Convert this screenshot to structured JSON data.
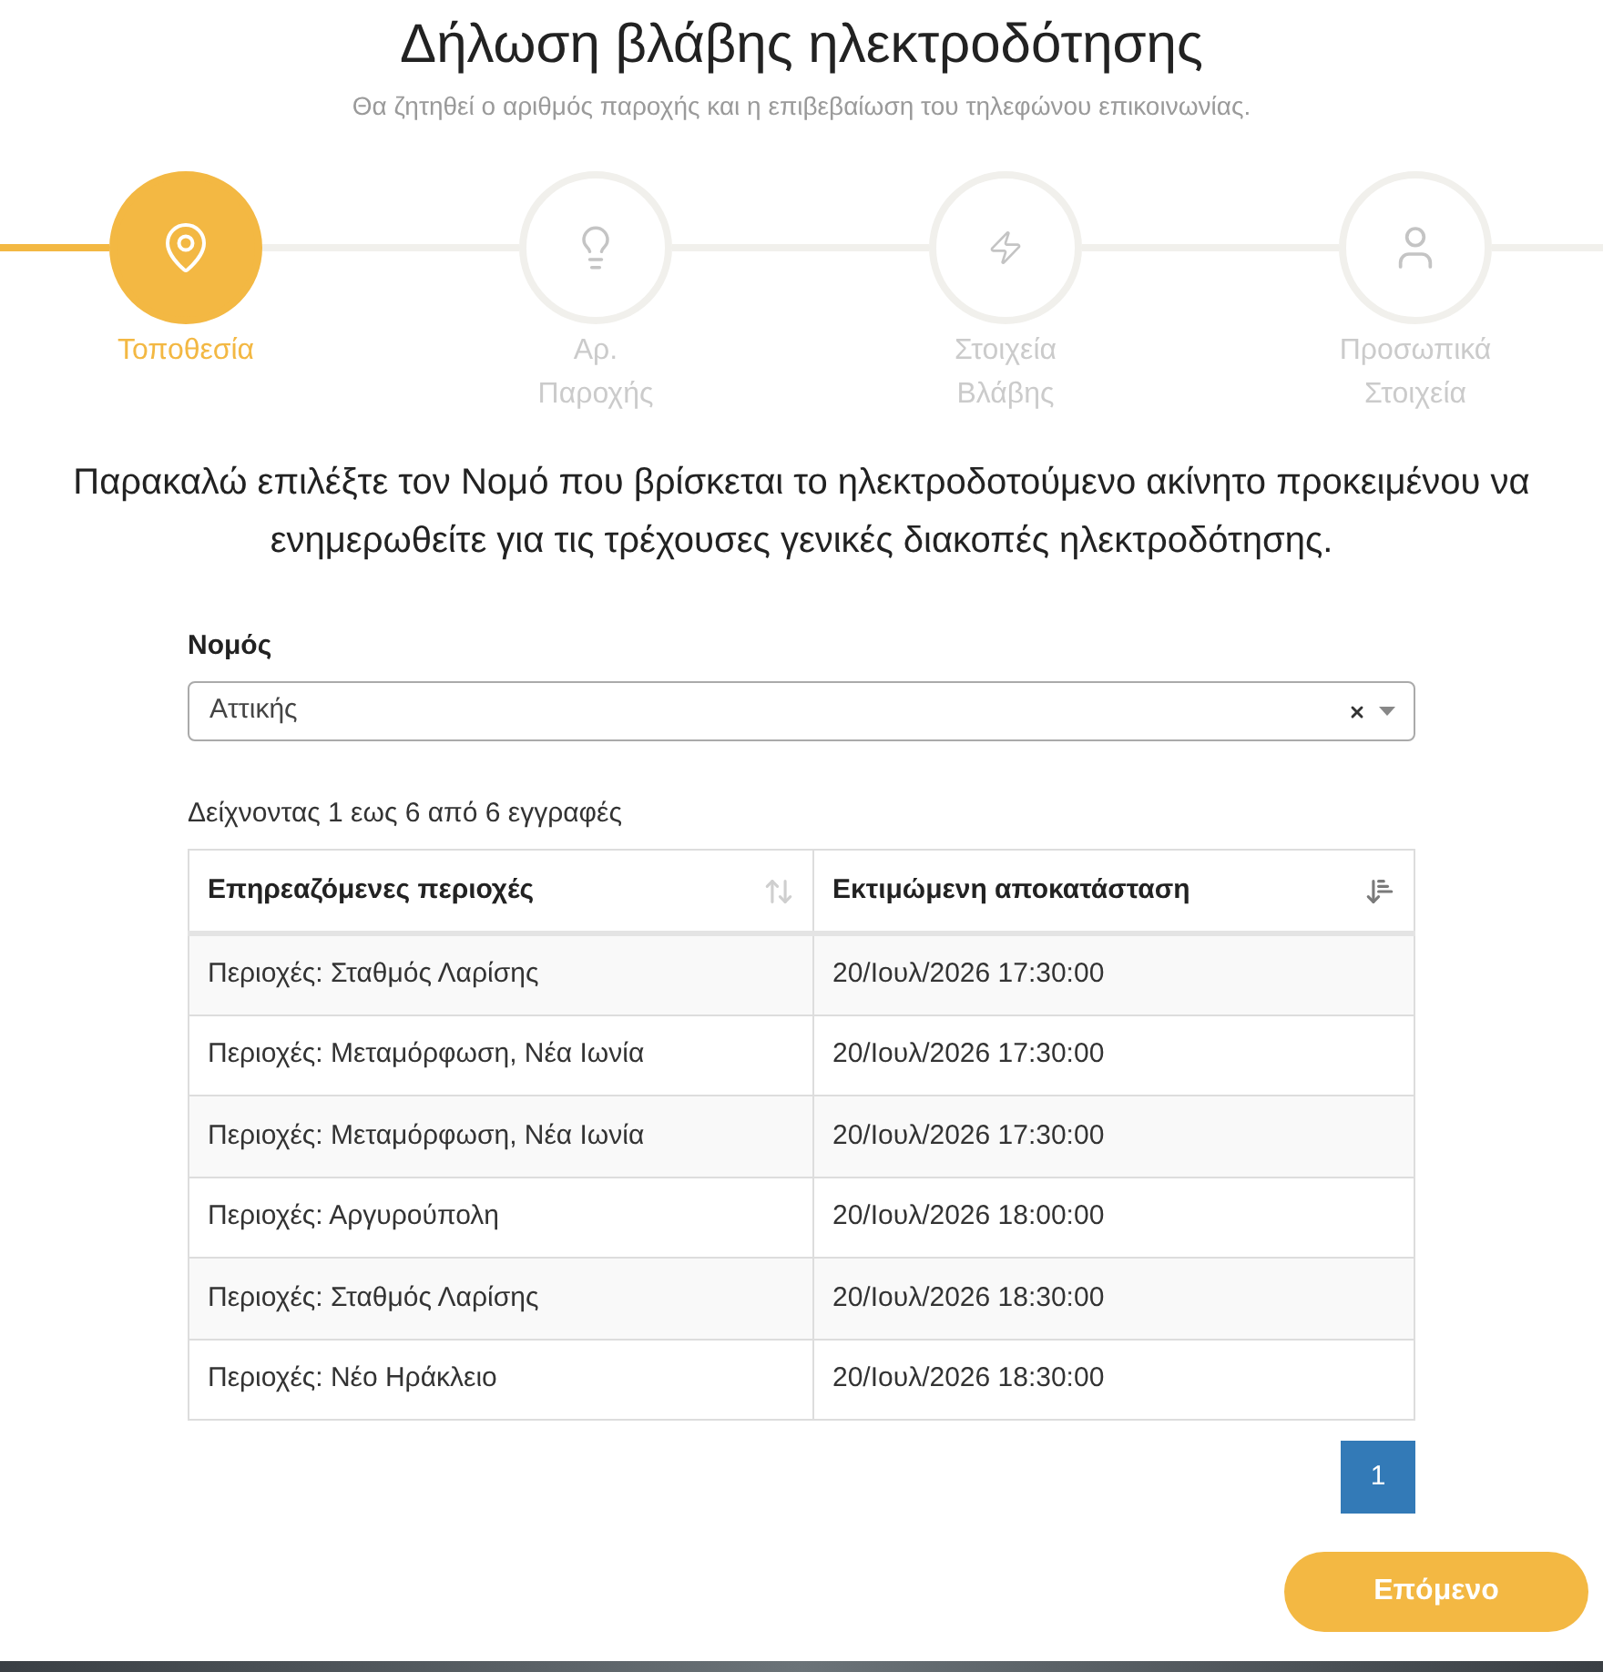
{
  "header": {
    "title": "Δήλωση βλάβης ηλεκτροδότησης",
    "subtitle": "Θα ζητηθεί ο αριθμός παροχής και η επιβεβαίωση του τηλεφώνου επικοινωνίας."
  },
  "steps": [
    {
      "label": [
        "Τοποθεσία"
      ],
      "selected": true
    },
    {
      "label": [
        "Αρ.",
        "Παροχής"
      ],
      "selected": false
    },
    {
      "label": [
        "Στοιχεία",
        "Βλάβης"
      ],
      "selected": false
    },
    {
      "label": [
        "Προσωπικά",
        "Στοιχεία"
      ],
      "selected": false
    }
  ],
  "instructions": "Παρακαλώ επιλέξτε τον Νομό που βρίσκεται το ηλεκτροδοτούμενο ακίνητο προκειμένου να ενημερωθείτε για τις τρέχουσες γενικές διακοπές ηλεκτροδότησης.",
  "prefecture": {
    "label": "Νομός",
    "value": "Αττικής"
  },
  "table": {
    "info": "Δείχνοντας 1 εως 6 από 6 εγγραφές",
    "columns": [
      {
        "label": "Επηρεαζόμενες περιοχές",
        "sorted": false
      },
      {
        "label": "Εκτιμώμενη αποκατάσταση",
        "sorted": true
      }
    ],
    "rows": [
      [
        "Περιοχές: Σταθμός Λαρίσης",
        "20/Ιουλ/2026 17:30:00"
      ],
      [
        "Περιοχές: Μεταμόρφωση, Νέα Ιωνία",
        "20/Ιουλ/2026 17:30:00"
      ],
      [
        "Περιοχές: Μεταμόρφωση, Νέα Ιωνία",
        "20/Ιουλ/2026 17:30:00"
      ],
      [
        "Περιοχές: Αργυρούπολη",
        "20/Ιουλ/2026 18:00:00"
      ],
      [
        "Περιοχές: Σταθμός Λαρίσης",
        "20/Ιουλ/2026 18:30:00"
      ],
      [
        "Περιοχές: Νέο Ηράκλειο",
        "20/Ιουλ/2026 18:30:00"
      ]
    ]
  },
  "pagination": [
    {
      "label": "1",
      "selected": true
    }
  ],
  "next_button": "Επόμενο"
}
